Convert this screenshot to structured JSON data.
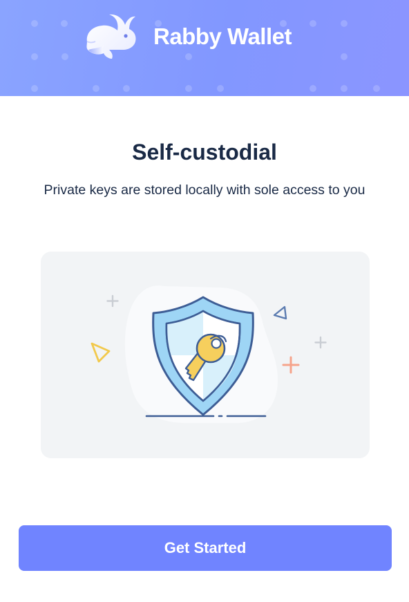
{
  "header": {
    "brand_name": "Rabby Wallet",
    "logo_icon": "rabbit-logo-icon",
    "background_colors": [
      "#8aa4ff",
      "#8b95ff"
    ]
  },
  "onboarding": {
    "title": "Self-custodial",
    "description": "Private keys are stored locally with sole access to you",
    "illustration": "shield-key-illustration"
  },
  "actions": {
    "get_started_label": "Get Started"
  },
  "colors": {
    "accent": "#7084ff",
    "text_primary": "#192945",
    "card_background": "#f2f4f6"
  }
}
